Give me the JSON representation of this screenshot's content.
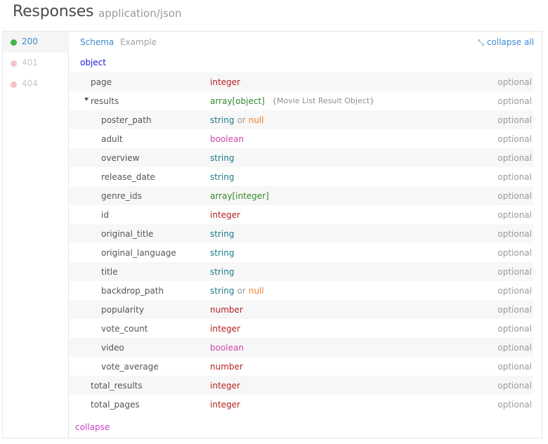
{
  "header": {
    "title": "Responses",
    "content_type": "application/json"
  },
  "status_codes": [
    {
      "code": "200",
      "state": "active"
    },
    {
      "code": "401",
      "state": "error"
    },
    {
      "code": "404",
      "state": "error"
    }
  ],
  "tabs": {
    "schema": "Schema",
    "example": "Example",
    "collapse_all": "collapse all"
  },
  "root_type": "object",
  "fields": [
    {
      "name": "page",
      "type": "integer",
      "required": "optional"
    },
    {
      "name": "results",
      "type": "array[object]",
      "note": "{Movie List Result Object}",
      "required": "optional"
    },
    {
      "name": "poster_path",
      "type": "string",
      "or_text": "or",
      "nullable": "null",
      "required": "optional"
    },
    {
      "name": "adult",
      "type": "boolean",
      "required": "optional"
    },
    {
      "name": "overview",
      "type": "string",
      "required": "optional"
    },
    {
      "name": "release_date",
      "type": "string",
      "required": "optional"
    },
    {
      "name": "genre_ids",
      "type": "array[integer]",
      "required": "optional"
    },
    {
      "name": "id",
      "type": "integer",
      "required": "optional"
    },
    {
      "name": "original_title",
      "type": "string",
      "required": "optional"
    },
    {
      "name": "original_language",
      "type": "string",
      "required": "optional"
    },
    {
      "name": "title",
      "type": "string",
      "required": "optional"
    },
    {
      "name": "backdrop_path",
      "type": "string",
      "or_text": "or",
      "nullable": "null",
      "required": "optional"
    },
    {
      "name": "popularity",
      "type": "number",
      "required": "optional"
    },
    {
      "name": "vote_count",
      "type": "integer",
      "required": "optional"
    },
    {
      "name": "video",
      "type": "boolean",
      "required": "optional"
    },
    {
      "name": "vote_average",
      "type": "number",
      "required": "optional"
    },
    {
      "name": "total_results",
      "type": "integer",
      "required": "optional"
    },
    {
      "name": "total_pages",
      "type": "integer",
      "required": "optional"
    }
  ],
  "footer": {
    "collapse": "collapse"
  },
  "colors": {
    "integer": "#b52020",
    "number": "#b52020",
    "string": "#1b7d8c",
    "boolean": "#d243a8",
    "array": "#2f8a2f",
    "null": "#f07e2c",
    "link": "#3d8bd0",
    "success_dot": "#45b24a",
    "error_dot": "#f3c3c3"
  }
}
